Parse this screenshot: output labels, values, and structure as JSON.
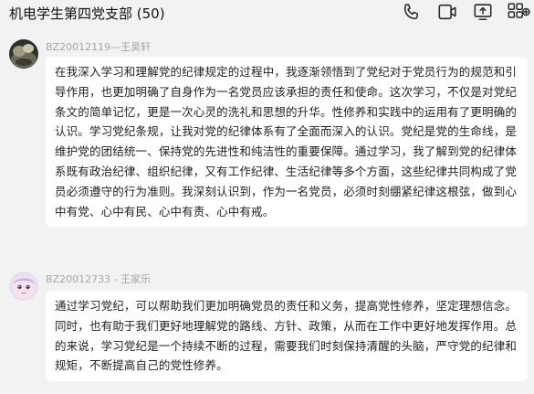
{
  "header": {
    "title": "机电学生第四党支部 (50)"
  },
  "toolbar": {
    "icons": [
      "phone-icon",
      "video-call-icon",
      "screen-share-icon",
      "apps-add-icon"
    ]
  },
  "messages": [
    {
      "sender": "BZ20012119—王昊轩",
      "text": "在我深入学习和理解党的纪律规定的过程中，我逐渐领悟到了党纪对于党员行为的规范和引导作用，也更加明确了自身作为一名党员应该承担的责任和使命。这次学习，不仅是对党纪条文的简单记忆，更是一次心灵的洗礼和思想的升华。性修养和实践中的运用有了更明确的认识。学习党纪条规，让我对党的纪律体系有了全面而深入的认识。党纪是党的生命线，是维护党的团结统一、保持党的先进性和纯洁性的重要保障。通过学习，我了解到党的纪律体系既有政治纪律、组织纪律，又有工作纪律、生活纪律等多个方面，这些纪律共同构成了党员必须遵守的行为准则。我深刻认识到，作为一名党员，必须时刻绷紧纪律这根弦，做到心中有党、心中有民、心中有责、心中有戒。"
    },
    {
      "sender": "BZ20012733 - 王家乐",
      "text": "通过学习党纪，可以帮助我们更加明确党员的责任和义务，提高党性修养，坚定理想信念。同时，也有助于我们更好地理解党的路线、方针、政策，从而在工作中更好地发挥作用。总的来说，学习党纪是一个持续不断的过程，需要我们时刻保持清醒的头脑，严守党的纪律和规矩，不断提高自己的党性修养。"
    }
  ],
  "colors": {
    "background": "#f2f2f2",
    "bubble": "#ffffff",
    "sender_text": "#a6a6a6",
    "icon": "#2b2b2b"
  }
}
